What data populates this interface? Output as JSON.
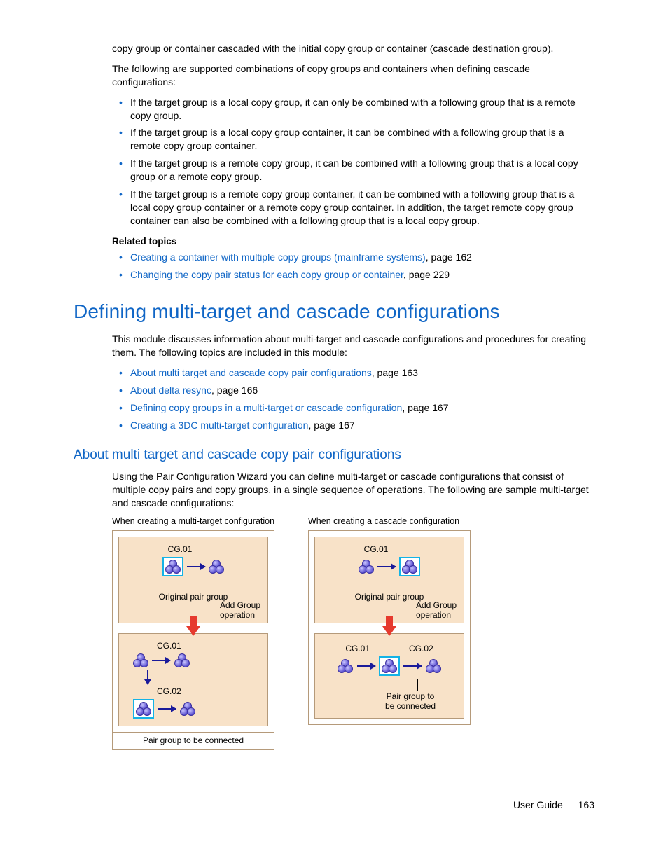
{
  "intro_para_top": "copy group or container cascaded with the initial copy group or container (cascade destination group).",
  "intro_para_2": "The following are supported combinations of copy groups and containers when defining cascade configurations:",
  "combo_bullets": [
    "If the target group is a local copy group, it can only be combined with a following group that is a remote copy group.",
    "If the target group is a local copy group container, it can be combined with a following group that is a remote copy group container.",
    "If the target group is a remote copy group, it can be combined with a following group that is a local copy group or a remote copy group.",
    "If the target group is a remote copy group container, it can be combined with a following group that is a local copy group container or a remote copy group container. In addition, the target remote copy group container can also be combined with a following group that is a local copy group."
  ],
  "related_heading": "Related topics",
  "related_links": [
    {
      "text": "Creating a container with multiple copy groups (mainframe systems)",
      "page": ", page 162"
    },
    {
      "text": "Changing the copy pair status for each copy group or container",
      "page": ", page 229"
    }
  ],
  "h1": "Defining multi-target and cascade configurations",
  "h1_para": "This module discusses information about multi-target and cascade configurations and procedures for creating them. The following topics are included in this module:",
  "toc_links": [
    {
      "text": "About multi target and cascade copy pair configurations",
      "page": ", page 163"
    },
    {
      "text": "About delta resync",
      "page": ", page 166"
    },
    {
      "text": "Defining copy groups in a multi-target or cascade configuration",
      "page": ", page 167"
    },
    {
      "text": "Creating a 3DC multi-target configuration",
      "page": ", page 167"
    }
  ],
  "h2": "About multi target and cascade copy pair configurations",
  "h2_para": "Using the Pair Configuration Wizard you can define multi-target or cascade configurations that consist of multiple copy pairs and copy groups, in a single sequence of operations. The following are sample multi-target and cascade configurations:",
  "diagram": {
    "left_title": "When creating a multi-target configuration",
    "right_title": "When creating a cascade configuration",
    "cg01": "CG.01",
    "cg02": "CG.02",
    "orig_pair": "Original pair group",
    "add_group": "Add Group\noperation",
    "pair_to_connect": "Pair group to be connected",
    "pair_to_connect_2line": "Pair group to\nbe connected"
  },
  "footer": {
    "label": "User Guide",
    "page": "163"
  }
}
